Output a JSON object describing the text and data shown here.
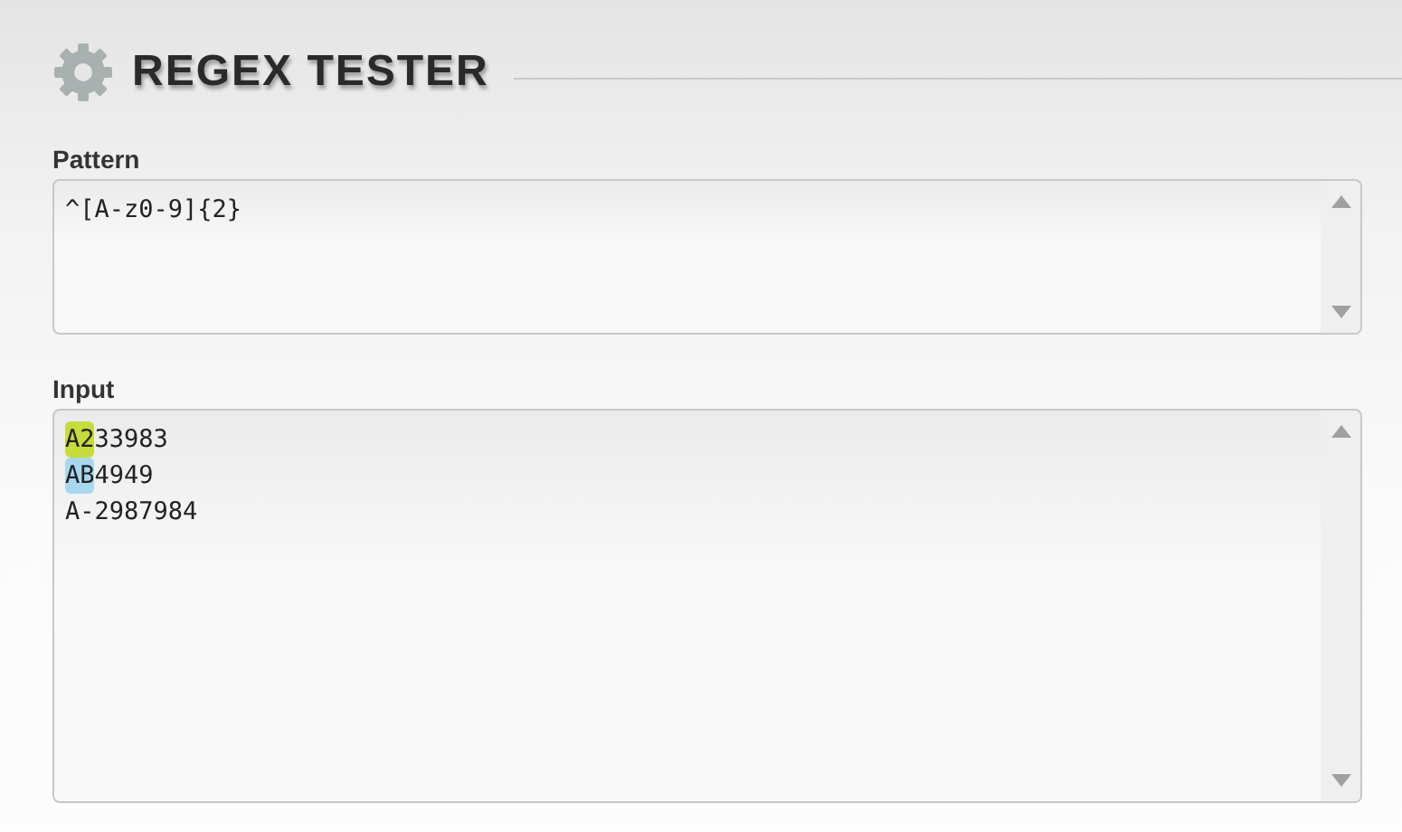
{
  "header": {
    "title": "REGEX TESTER"
  },
  "pattern": {
    "label": "Pattern",
    "value": "^[A-z0-9]{2}"
  },
  "input": {
    "label": "Input",
    "lines": [
      {
        "segments": [
          {
            "text": "A2",
            "color": "#c5dc3a"
          },
          {
            "text": "33983"
          }
        ]
      },
      {
        "segments": [
          {
            "text": "AB",
            "color": "#a8d8f0"
          },
          {
            "text": "4949"
          }
        ]
      },
      {
        "segments": [
          {
            "text": "A-2987984"
          }
        ]
      }
    ]
  }
}
